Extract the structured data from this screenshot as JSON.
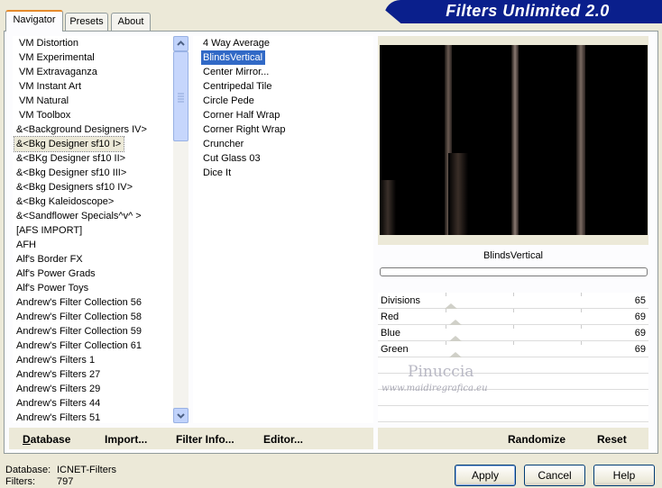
{
  "tabs": [
    {
      "label": "Navigator",
      "active": true
    },
    {
      "label": "Presets",
      "active": false
    },
    {
      "label": "About",
      "active": false
    }
  ],
  "banner": {
    "title": "Filters Unlimited 2.0",
    "color": "#0a1f8c"
  },
  "categories": [
    "VM Distortion",
    "VM Experimental",
    "VM Extravaganza",
    "VM Instant Art",
    "VM Natural",
    "VM Toolbox",
    "&<Background Designers IV>",
    "&<Bkg Designer sf10 I>",
    "&<BKg Designer sf10 II>",
    "&<Bkg Designer sf10 III>",
    "&<Bkg Designers sf10 IV>",
    "&<Bkg Kaleidoscope>",
    "&<Sandflower Specials^v^ >",
    "[AFS IMPORT]",
    "AFH",
    "Alf's Border FX",
    "Alf's Power Grads",
    "Alf's Power Toys",
    "Andrew's Filter Collection 56",
    "Andrew's Filter Collection 58",
    "Andrew's Filter Collection 59",
    "Andrew's Filter Collection 61",
    "Andrew's Filters 1",
    "Andrew's Filters 27",
    "Andrew's Filters 29",
    "Andrew's Filters 44",
    "Andrew's Filters 51"
  ],
  "selected_category": "&<Bkg Designer sf10 I>",
  "filters": [
    "4 Way Average",
    "BlindsVertical",
    "Center Mirror...",
    "Centripedal Tile",
    "Circle Pede",
    "Corner Half Wrap",
    "Corner Right Wrap",
    "Cruncher",
    "Cut Glass 03",
    "Dice It"
  ],
  "selected_filter": "BlindsVertical",
  "preview": {
    "filter_name": "BlindsVertical"
  },
  "params": [
    {
      "label": "Divisions",
      "value": "65"
    },
    {
      "label": "Red",
      "value": "69"
    },
    {
      "label": "Blue",
      "value": "69"
    },
    {
      "label": "Green",
      "value": "69"
    }
  ],
  "watermark": {
    "line1": "Pinuccia",
    "line2": "www.maidiregrafica.eu"
  },
  "toolbar": {
    "database": "Database",
    "import": "Import...",
    "filter_info": "Filter Info...",
    "editor": "Editor...",
    "randomize": "Randomize",
    "reset": "Reset"
  },
  "status": {
    "database_label": "Database:",
    "database_value": "ICNET-Filters",
    "filters_label": "Filters:",
    "filters_value": "797"
  },
  "buttons": {
    "apply": "Apply",
    "cancel": "Cancel",
    "help": "Help"
  }
}
